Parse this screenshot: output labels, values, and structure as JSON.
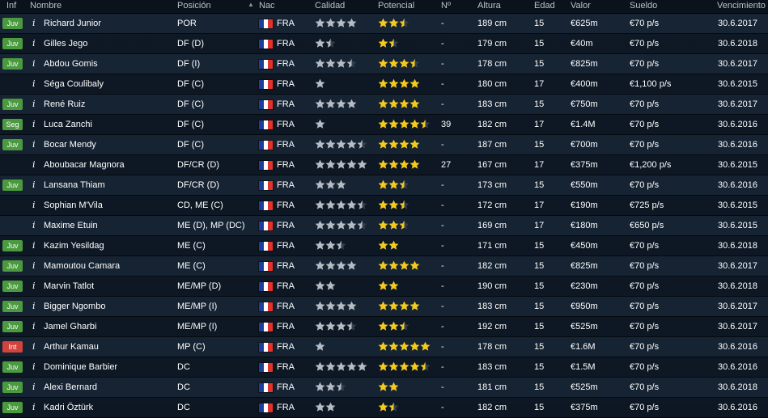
{
  "headers": {
    "inf": "Inf",
    "nombre": "Nombre",
    "posicion": "Posición",
    "nac": "Nac",
    "calidad": "Calidad",
    "potencial": "Potencial",
    "num": "Nº",
    "altura": "Altura",
    "edad": "Edad",
    "valor": "Valor",
    "sueldo": "Sueldo",
    "vencimiento": "Vencimiento"
  },
  "colors": {
    "badge_juv": "#4c9a40",
    "badge_seg": "#4c9a40",
    "badge_int": "#d2433d",
    "star_quality": "#b6bcc3",
    "star_potential": "#f4cb1d",
    "flag_blue": "#1f3d9c",
    "flag_white": "#ffffff",
    "flag_red": "#e2322c"
  },
  "info_icon": "i",
  "players": [
    {
      "inf": "Juv",
      "name": "Richard Junior",
      "pos": "POR",
      "nat": "FRA",
      "quality": 4,
      "potential": 2.5,
      "num": "-",
      "height": "189 cm",
      "age": "15",
      "value": "€625m",
      "wage": "€70 p/s",
      "expires": "30.6.2017"
    },
    {
      "inf": "Juv",
      "name": "Gilles Jego",
      "pos": "DF (D)",
      "nat": "FRA",
      "quality": 1.5,
      "potential": 1.5,
      "num": "-",
      "height": "179 cm",
      "age": "15",
      "value": "€40m",
      "wage": "€70 p/s",
      "expires": "30.6.2018"
    },
    {
      "inf": "Juv",
      "name": "Abdou Gomis",
      "pos": "DF (I)",
      "nat": "FRA",
      "quality": 3.5,
      "potential": 3.5,
      "num": "-",
      "height": "178 cm",
      "age": "15",
      "value": "€825m",
      "wage": "€70 p/s",
      "expires": "30.6.2017"
    },
    {
      "inf": "",
      "name": "Séga Coulibaly",
      "pos": "DF (C)",
      "nat": "FRA",
      "quality": 1,
      "potential": 4,
      "num": "-",
      "height": "180 cm",
      "age": "17",
      "value": "€400m",
      "wage": "€1,100 p/s",
      "expires": "30.6.2015"
    },
    {
      "inf": "Juv",
      "name": "René Ruiz",
      "pos": "DF (C)",
      "nat": "FRA",
      "quality": 4,
      "potential": 4,
      "num": "-",
      "height": "183 cm",
      "age": "15",
      "value": "€750m",
      "wage": "€70 p/s",
      "expires": "30.6.2017"
    },
    {
      "inf": "Seg",
      "name": "Luca Zanchi",
      "pos": "DF (C)",
      "nat": "FRA",
      "quality": 1,
      "potential": 4.5,
      "num": "39",
      "height": "182 cm",
      "age": "17",
      "value": "€1.4M",
      "wage": "€70 p/s",
      "expires": "30.6.2016"
    },
    {
      "inf": "Juv",
      "name": "Bocar Mendy",
      "pos": "DF (C)",
      "nat": "FRA",
      "quality": 4.5,
      "potential": 4,
      "num": "-",
      "height": "187 cm",
      "age": "15",
      "value": "€700m",
      "wage": "€70 p/s",
      "expires": "30.6.2016"
    },
    {
      "inf": "",
      "name": "Aboubacar Magnora",
      "pos": "DF/CR (D)",
      "nat": "FRA",
      "quality": 5,
      "potential": 4,
      "num": "27",
      "height": "167 cm",
      "age": "17",
      "value": "€375m",
      "wage": "€1,200 p/s",
      "expires": "30.6.2015"
    },
    {
      "inf": "Juv",
      "name": "Lansana Thiam",
      "pos": "DF/CR (D)",
      "nat": "FRA",
      "quality": 3,
      "potential": 2.5,
      "num": "-",
      "height": "173 cm",
      "age": "15",
      "value": "€550m",
      "wage": "€70 p/s",
      "expires": "30.6.2016"
    },
    {
      "inf": "",
      "name": "Sophian M'Vila",
      "pos": "CD, ME (C)",
      "nat": "FRA",
      "quality": 4.5,
      "potential": 2.5,
      "num": "-",
      "height": "172 cm",
      "age": "17",
      "value": "€190m",
      "wage": "€725 p/s",
      "expires": "30.6.2015"
    },
    {
      "inf": "",
      "name": "Maxime Etuin",
      "pos": "ME (D), MP (DC)",
      "nat": "FRA",
      "quality": 4.5,
      "potential": 2.5,
      "num": "-",
      "height": "169 cm",
      "age": "17",
      "value": "€180m",
      "wage": "€650 p/s",
      "expires": "30.6.2015"
    },
    {
      "inf": "Juv",
      "name": "Kazim Yesildag",
      "pos": "ME (C)",
      "nat": "FRA",
      "quality": 2.5,
      "potential": 2,
      "num": "-",
      "height": "171 cm",
      "age": "15",
      "value": "€450m",
      "wage": "€70 p/s",
      "expires": "30.6.2018"
    },
    {
      "inf": "Juv",
      "name": "Mamoutou Camara",
      "pos": "ME (C)",
      "nat": "FRA",
      "quality": 4,
      "potential": 4,
      "num": "-",
      "height": "182 cm",
      "age": "15",
      "value": "€825m",
      "wage": "€70 p/s",
      "expires": "30.6.2017"
    },
    {
      "inf": "Juv",
      "name": "Marvin Tatlot",
      "pos": "ME/MP (D)",
      "nat": "FRA",
      "quality": 2,
      "potential": 2,
      "num": "-",
      "height": "190 cm",
      "age": "15",
      "value": "€230m",
      "wage": "€70 p/s",
      "expires": "30.6.2018"
    },
    {
      "inf": "Juv",
      "name": "Bigger Ngombo",
      "pos": "ME/MP (I)",
      "nat": "FRA",
      "quality": 4,
      "potential": 4,
      "num": "-",
      "height": "183 cm",
      "age": "15",
      "value": "€950m",
      "wage": "€70 p/s",
      "expires": "30.6.2017"
    },
    {
      "inf": "Juv",
      "name": "Jamel Gharbi",
      "pos": "ME/MP (I)",
      "nat": "FRA",
      "quality": 3.5,
      "potential": 2.5,
      "num": "-",
      "height": "192 cm",
      "age": "15",
      "value": "€525m",
      "wage": "€70 p/s",
      "expires": "30.6.2017"
    },
    {
      "inf": "Int",
      "name": "Arthur Kamau",
      "pos": "MP (C)",
      "nat": "FRA",
      "quality": 1,
      "potential": 5,
      "num": "-",
      "height": "178 cm",
      "age": "15",
      "value": "€1.6M",
      "wage": "€70 p/s",
      "expires": "30.6.2016"
    },
    {
      "inf": "Juv",
      "name": "Dominique Barbier",
      "pos": "DC",
      "nat": "FRA",
      "quality": 5,
      "potential": 4.5,
      "num": "-",
      "height": "183 cm",
      "age": "15",
      "value": "€1.5M",
      "wage": "€70 p/s",
      "expires": "30.6.2016"
    },
    {
      "inf": "Juv",
      "name": "Alexi Bernard",
      "pos": "DC",
      "nat": "FRA",
      "quality": 2.5,
      "potential": 2,
      "num": "-",
      "height": "181 cm",
      "age": "15",
      "value": "€525m",
      "wage": "€70 p/s",
      "expires": "30.6.2018"
    },
    {
      "inf": "Juv",
      "name": "Kadri Öztürk",
      "pos": "DC",
      "nat": "FRA",
      "quality": 2,
      "potential": 1.5,
      "num": "-",
      "height": "182 cm",
      "age": "15",
      "value": "€375m",
      "wage": "€70 p/s",
      "expires": "30.6.2016"
    }
  ]
}
